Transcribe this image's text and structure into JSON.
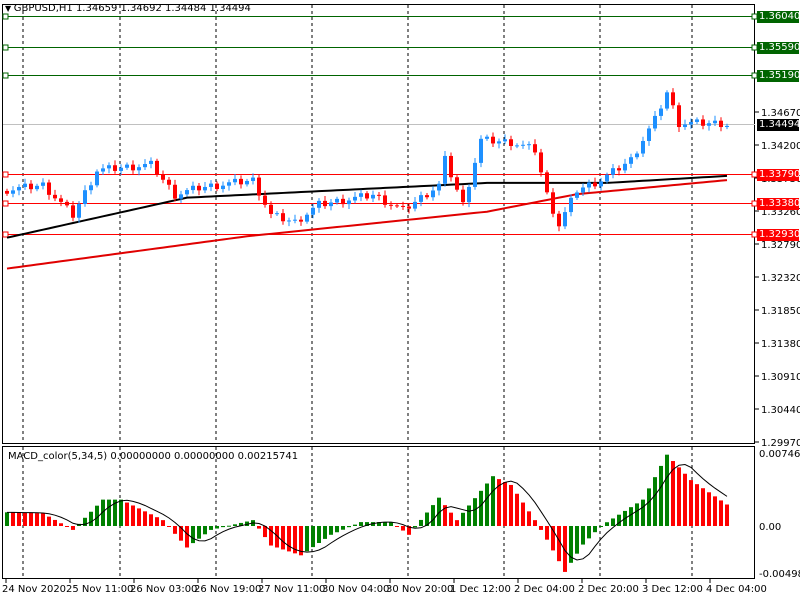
{
  "header": {
    "symbol_info": "GBPUSD,H1  1.34659 1.34692 1.34484 1.34494",
    "menu_icon": "triangle-down-icon"
  },
  "macd": {
    "title": "MACD_color(5,34,5) 0.00000000 0.00000000 0.00215741",
    "axis": [
      "0.0074696",
      "0.00",
      "-0.004987"
    ],
    "max": 0.0074696,
    "min": -0.004987,
    "hist_path": [
      [
        0,
        0.0014
      ],
      [
        6,
        0.0013
      ],
      [
        11,
        -0.0004
      ],
      [
        16,
        0.0027
      ],
      [
        19,
        0.0027
      ],
      [
        26,
        0.0006
      ],
      [
        30,
        -0.0022
      ],
      [
        34,
        -0.0004
      ],
      [
        41,
        0.0006
      ],
      [
        44,
        -0.002
      ],
      [
        49,
        -0.003
      ],
      [
        54,
        -0.0009
      ],
      [
        59,
        0.0004
      ],
      [
        64,
        0.0004
      ],
      [
        67,
        -0.0009
      ],
      [
        72,
        0.0029
      ],
      [
        75,
        0.0006
      ],
      [
        81,
        0.0051
      ],
      [
        84,
        0.0042
      ],
      [
        88,
        0.0006
      ],
      [
        90,
        -0.0014
      ],
      [
        93,
        -0.0047
      ],
      [
        96,
        -0.0019
      ],
      [
        99,
        0
      ],
      [
        106,
        0.0027
      ],
      [
        110,
        0.0073
      ],
      [
        114,
        0.0047
      ],
      [
        120,
        0.0022
      ]
    ],
    "colors": {
      "up": "#008000",
      "down": "#ff0000",
      "signal": "#000000"
    }
  },
  "price_axis": {
    "ticks": [
      "1.34670",
      "1.34200",
      "1.33730",
      "1.33260",
      "1.32790",
      "1.32320",
      "1.31850",
      "1.31380",
      "1.30910",
      "1.30440",
      "1.29970"
    ],
    "current": "1.34494"
  },
  "levels": [
    {
      "price": "1.36040",
      "color": "#006400"
    },
    {
      "price": "1.35590",
      "color": "#006400"
    },
    {
      "price": "1.35190",
      "color": "#006400"
    },
    {
      "price": "1.33790",
      "color": "#ff0000"
    },
    {
      "price": "1.33380",
      "color": "#ff0000"
    },
    {
      "price": "1.32930",
      "color": "#ff0000"
    }
  ],
  "time_axis": [
    "24 Nov 2020",
    "25 Nov 11:00",
    "26 Nov 03:00",
    "26 Nov 19:00",
    "27 Nov 11:00",
    "30 Nov 04:00",
    "30 Nov 20:00",
    "1 Dec 12:00",
    "2 Dec 04:00",
    "2 Dec 20:00",
    "3 Dec 12:00",
    "4 Dec 04:00"
  ],
  "chart_data": {
    "type": "candlestick",
    "symbol": "GBPUSD",
    "timeframe": "H1",
    "bars": 121,
    "close_path": [
      [
        0,
        1.3356
      ],
      [
        6,
        1.3363
      ],
      [
        11,
        1.332
      ],
      [
        15,
        1.3384
      ],
      [
        24,
        1.3392
      ],
      [
        28,
        1.3349
      ],
      [
        32,
        1.3359
      ],
      [
        41,
        1.337
      ],
      [
        44,
        1.332
      ],
      [
        48,
        1.331
      ],
      [
        52,
        1.3335
      ],
      [
        61,
        1.3349
      ],
      [
        66,
        1.3327
      ],
      [
        72,
        1.3363
      ],
      [
        73,
        1.3399
      ],
      [
        76,
        1.3335
      ],
      [
        79,
        1.3427
      ],
      [
        84,
        1.3424
      ],
      [
        88,
        1.3413
      ],
      [
        90,
        1.3349
      ],
      [
        92,
        1.3306
      ],
      [
        95,
        1.3356
      ],
      [
        99,
        1.337
      ],
      [
        104,
        1.3399
      ],
      [
        108,
        1.3456
      ],
      [
        110,
        1.3495
      ],
      [
        112,
        1.3451
      ],
      [
        119,
        1.3451
      ],
      [
        120,
        1.3449
      ]
    ],
    "ma_black": [
      [
        0,
        1.3288
      ],
      [
        30,
        1.3345
      ],
      [
        80,
        1.3366
      ],
      [
        100,
        1.3366
      ],
      [
        120,
        1.3376
      ]
    ],
    "ma_red": [
      [
        0,
        1.3244
      ],
      [
        40,
        1.329
      ],
      [
        80,
        1.3325
      ],
      [
        95,
        1.335
      ],
      [
        120,
        1.337
      ]
    ],
    "colors": {
      "bull": "#1e90ff",
      "bear": "#ff0000"
    }
  }
}
